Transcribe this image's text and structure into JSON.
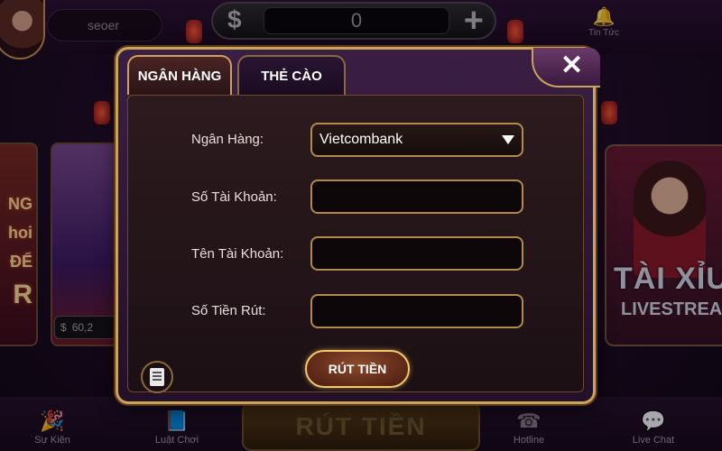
{
  "header": {
    "username": "seoer",
    "balance": "0",
    "news_label": "Tin Tức"
  },
  "left_promo": {
    "text_lines": [
      "NG",
      "hoi",
      "ĐỂ",
      "R"
    ],
    "balance": "60,2"
  },
  "right_promo": {
    "title": "TÀI XỈU",
    "subtitle": "LIVESTREAM"
  },
  "footer": {
    "nav": [
      "Sự Kiện",
      "Luật Chơi",
      "Hotline",
      "Live Chat"
    ],
    "underlay_button": "RÚT TIỀN"
  },
  "modal": {
    "tabs": [
      {
        "label": "NGÂN HÀNG",
        "active": true
      },
      {
        "label": "THẺ CÀO",
        "active": false
      }
    ],
    "form": {
      "bank_label": "Ngân Hàng:",
      "bank_value": "Vietcombank",
      "account_number_label": "Số Tài Khoản:",
      "account_number_value": "",
      "account_name_label": "Tên Tài Khoản:",
      "account_name_value": "",
      "amount_label": "Số Tiền Rút:",
      "amount_value": ""
    },
    "submit_label": "RÚT TIỀN"
  },
  "icons": {
    "close": "close-icon",
    "history": "document-icon",
    "dropdown": "caret-down-icon"
  },
  "colors": {
    "gold_border": "#c9a45a",
    "modal_bg": "#241028",
    "field_bg": "#0e070a"
  }
}
